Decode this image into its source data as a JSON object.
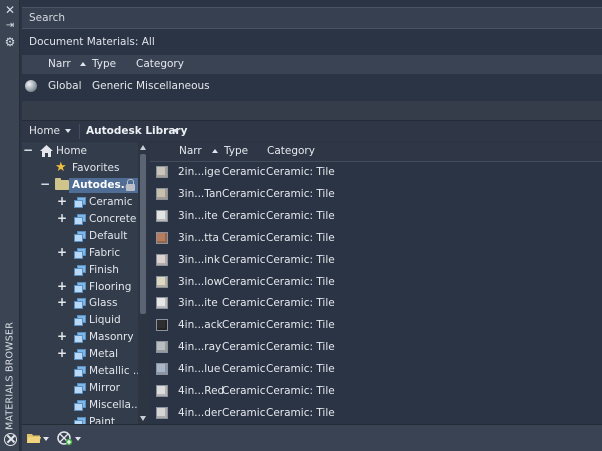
{
  "panel": {
    "vertical_title": "MATERIALS BROWSER"
  },
  "search": {
    "placeholder": "Search"
  },
  "document_materials": {
    "label": "Document Materials: All",
    "columns": {
      "name": "Narr",
      "type": "Type",
      "category": "Category"
    },
    "rows": [
      {
        "name": "Global",
        "type": "Generic",
        "category": "Miscellaneous"
      }
    ]
  },
  "library_bar": {
    "home": "Home",
    "library": "Autodesk Library"
  },
  "tree": {
    "root": "Home",
    "favorites": "Favorites",
    "library": "Autodes...",
    "items": [
      {
        "label": "Ceramic",
        "expand": "+"
      },
      {
        "label": "Concrete",
        "expand": "+"
      },
      {
        "label": "Default",
        "expand": ""
      },
      {
        "label": "Fabric",
        "expand": "+"
      },
      {
        "label": "Finish",
        "expand": ""
      },
      {
        "label": "Flooring",
        "expand": "+"
      },
      {
        "label": "Glass",
        "expand": "+"
      },
      {
        "label": "Liquid",
        "expand": ""
      },
      {
        "label": "Masonry",
        "expand": "+"
      },
      {
        "label": "Metal",
        "expand": "+"
      },
      {
        "label": "Metallic ...",
        "expand": ""
      },
      {
        "label": "Mirror",
        "expand": ""
      },
      {
        "label": "Miscella...",
        "expand": ""
      },
      {
        "label": "Paint",
        "expand": ""
      }
    ]
  },
  "materials": {
    "columns": {
      "name": "Narr",
      "type": "Type",
      "category": "Category"
    },
    "rows": [
      {
        "name": "2in...ige",
        "type": "Ceramic",
        "category": "Ceramic: Tile",
        "swatch": "#c9c4ba"
      },
      {
        "name": "3in...Tan",
        "type": "Ceramic",
        "category": "Ceramic: Tile",
        "swatch": "#c7bfae"
      },
      {
        "name": "3in...ite",
        "type": "Ceramic",
        "category": "Ceramic: Tile",
        "swatch": "#e4e4e4"
      },
      {
        "name": "3in...tta",
        "type": "Ceramic",
        "category": "Ceramic: Tile",
        "swatch": "#b57c5e"
      },
      {
        "name": "3in...ink",
        "type": "Ceramic",
        "category": "Ceramic: Tile",
        "swatch": "#dcd2d2"
      },
      {
        "name": "3in...low",
        "type": "Ceramic",
        "category": "Ceramic: Tile",
        "swatch": "#dcd8c4"
      },
      {
        "name": "3in...ite",
        "type": "Ceramic",
        "category": "Ceramic: Tile",
        "swatch": "#e6e6e6"
      },
      {
        "name": "4in...ack",
        "type": "Ceramic",
        "category": "Ceramic: Tile",
        "swatch": "#2e2e30"
      },
      {
        "name": "4in...ray",
        "type": "Ceramic",
        "category": "Ceramic: Tile",
        "swatch": "#b9bcc0"
      },
      {
        "name": "4in...lue",
        "type": "Ceramic",
        "category": "Ceramic: Tile",
        "swatch": "#a9b5c8"
      },
      {
        "name": "4in...Red",
        "type": "Ceramic",
        "category": "Ceramic: Tile",
        "swatch": "#dcdcdc"
      },
      {
        "name": "4in...der",
        "type": "Ceramic",
        "category": "Ceramic: Tile",
        "swatch": "#d5d5d5"
      }
    ]
  },
  "colors": {
    "selection": "#4f6d95",
    "background": "#2b3445",
    "panel": "#333c4b"
  }
}
